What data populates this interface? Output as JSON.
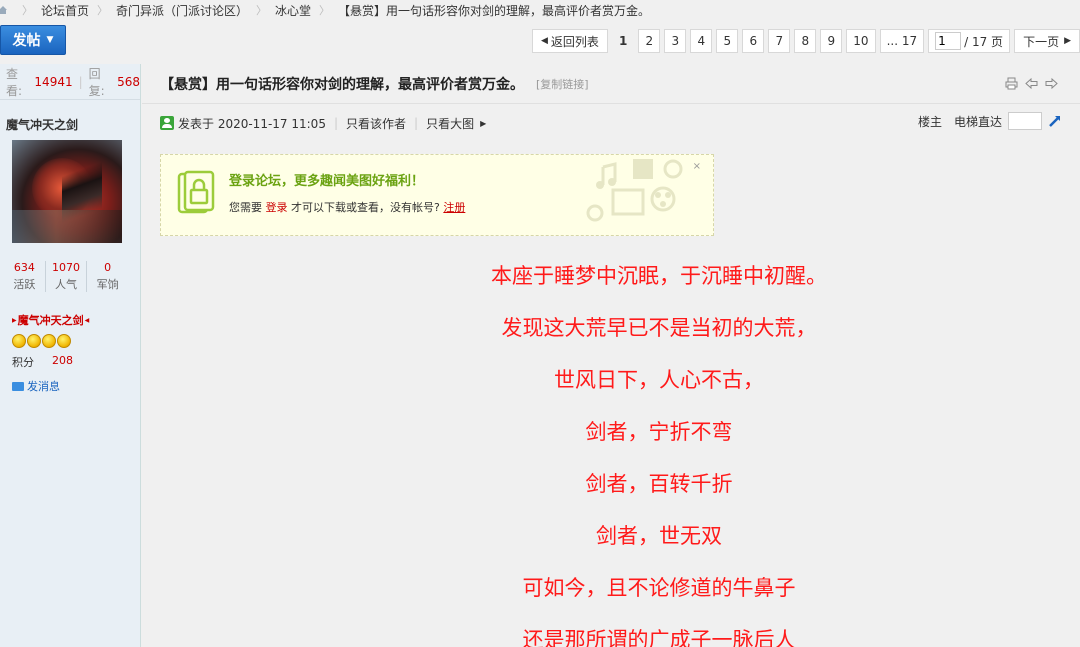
{
  "breadcrumb": {
    "items": [
      "论坛首页",
      "奇门异派（门派讨论区）",
      "冰心堂",
      "【悬赏】用一句话形容你对剑的理解，最高评价者赏万金。"
    ]
  },
  "toolbar": {
    "post_label": "发帖",
    "back_label": "返回列表",
    "pages": [
      "1",
      "2",
      "3",
      "4",
      "5",
      "6",
      "7",
      "8",
      "9",
      "10"
    ],
    "more_label": "... 17",
    "page_input": "1",
    "total_label": "/ 17 页",
    "next_label": "下一页"
  },
  "sidebar": {
    "view_label": "查看:",
    "views": "14941",
    "reply_label": "回复:",
    "replies": "568",
    "author_name": "魔气冲天之剑",
    "stats": [
      {
        "value": "634",
        "label": "活跃"
      },
      {
        "value": "1070",
        "label": "人气"
      },
      {
        "value": "0",
        "label": "军饷"
      }
    ],
    "nickname": "魔气冲天之剑",
    "score_label": "积分",
    "score_value": "208",
    "message_label": "发消息"
  },
  "post": {
    "title": "【悬赏】用一句话形容你对剑的理解，最高评价者赏万金。",
    "copy_link": "[复制链接]",
    "posted_at": "发表于 2020-11-17 11:05",
    "only_author": "只看该作者",
    "only_images": "只看大图",
    "floor_label": "楼主",
    "elevator_label": "电梯直达"
  },
  "login_box": {
    "title": "登录论坛，更多趣闻美图好福利！",
    "text_before": "您需要",
    "login_link": "登录",
    "text_middle": "才可以下载或查看，没有帐号?",
    "register_link": "注册",
    "close": "×"
  },
  "poem": {
    "lines": [
      "本座于睡梦中沉眠，于沉睡中初醒。",
      "发现这大荒早已不是当初的大荒，",
      "世风日下，人心不古，",
      "剑者，宁折不弯",
      "剑者，百转千折",
      "剑者，世无双",
      "可如今，且不论修道的牛鼻子",
      "还是那所谓的广成子一脉后人"
    ]
  },
  "colors": {
    "accent_blue": "#1a64bf",
    "poem_red": "#ff1a1a",
    "stat_red": "#cc0000",
    "login_green": "#6ba312"
  }
}
